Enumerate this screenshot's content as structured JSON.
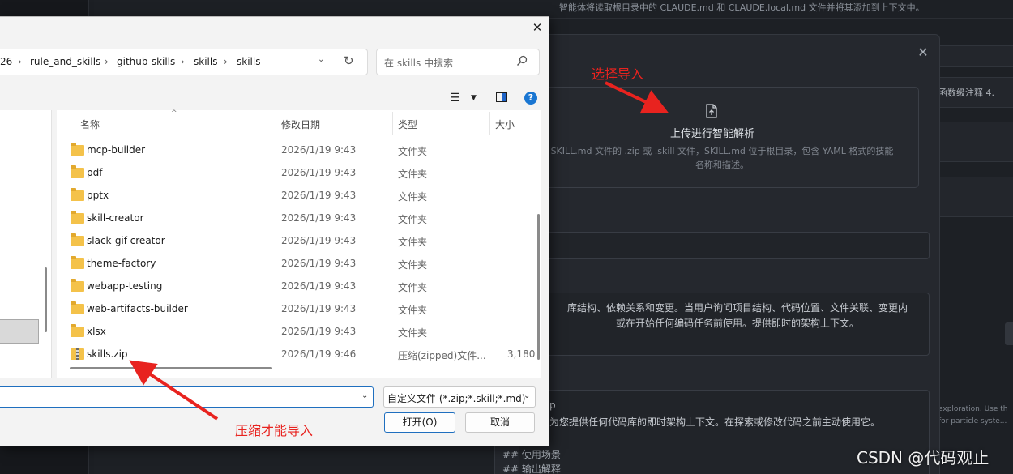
{
  "background": {
    "top_note": "智能体将读取根目录中的 CLAUDE.md 和 CLAUDE.local.md 文件并将其添加到上下文中。",
    "right_snippets": [
      "函数级注释 4.",
      "exploration. Use th",
      "for particle syste..."
    ]
  },
  "skill_modal": {
    "close_glyph": "✕",
    "upload_title": "上传进行智能解析",
    "upload_desc_line1": "SKILL.md 文件的 .zip 或 .skill 文件，SKILL.md 位于根目录，包含 YAML 格式的技能",
    "upload_desc_line2": "名称和描述。",
    "description_line1": "库结构、依赖关系和变更。当用户询问项目结构、代码位置、文件关联、变更内",
    "description_line2": "或在开始任何编码任务前使用。提供即时的架构上下文。",
    "content_line1": "p",
    "content_line2": "为您提供任何代码库的即时架构上下文。在探索或修改代码之前主动使用它。",
    "md_heading1": "## 使用场景",
    "md_heading2": "## 输出解释"
  },
  "file_dialog": {
    "close_glyph": "✕",
    "breadcrumbs": [
      "26",
      "rule_and_skills",
      "github-skills",
      "skills",
      "skills"
    ],
    "search_placeholder": "在 skills 中搜索",
    "columns": {
      "name": "名称",
      "date": "修改日期",
      "type": "类型",
      "size": "大小"
    },
    "rows": [
      {
        "name": "mcp-builder",
        "date": "2026/1/19 9:43",
        "type": "文件夹",
        "size": "",
        "kind": "folder"
      },
      {
        "name": "pdf",
        "date": "2026/1/19 9:43",
        "type": "文件夹",
        "size": "",
        "kind": "folder"
      },
      {
        "name": "pptx",
        "date": "2026/1/19 9:43",
        "type": "文件夹",
        "size": "",
        "kind": "folder"
      },
      {
        "name": "skill-creator",
        "date": "2026/1/19 9:43",
        "type": "文件夹",
        "size": "",
        "kind": "folder"
      },
      {
        "name": "slack-gif-creator",
        "date": "2026/1/19 9:43",
        "type": "文件夹",
        "size": "",
        "kind": "folder"
      },
      {
        "name": "theme-factory",
        "date": "2026/1/19 9:43",
        "type": "文件夹",
        "size": "",
        "kind": "folder"
      },
      {
        "name": "webapp-testing",
        "date": "2026/1/19 9:43",
        "type": "文件夹",
        "size": "",
        "kind": "folder"
      },
      {
        "name": "web-artifacts-builder",
        "date": "2026/1/19 9:43",
        "type": "文件夹",
        "size": "",
        "kind": "folder"
      },
      {
        "name": "xlsx",
        "date": "2026/1/19 9:43",
        "type": "文件夹",
        "size": "",
        "kind": "folder"
      },
      {
        "name": "skills.zip",
        "date": "2026/1/19 9:46",
        "type": "压缩(zipped)文件...",
        "size": "3,180",
        "kind": "zip"
      }
    ],
    "filename_value": "",
    "file_type_filter": "自定义文件 (*.zip;*.skill;*.md)",
    "open_button": "打开(O)",
    "cancel_button": "取消"
  },
  "annotations": {
    "select_import": "选择导入",
    "zip_required": "压缩才能导入",
    "color": "#e8231f"
  },
  "watermark": "CSDN @代码观止"
}
